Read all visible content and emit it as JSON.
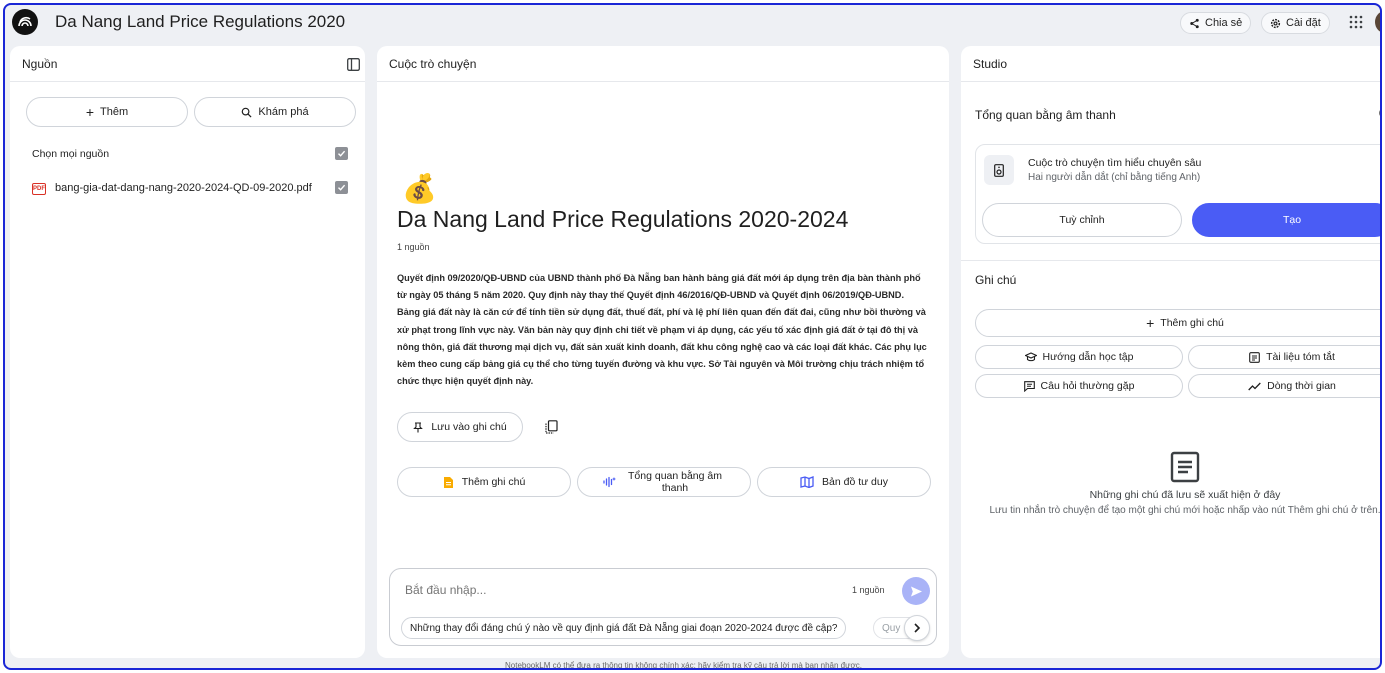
{
  "header": {
    "title": "Da Nang Land Price Regulations 2020-2024",
    "share_label": "Chia sẻ",
    "settings_label": "Cài đặt"
  },
  "sources": {
    "panel_title": "Nguồn",
    "add_label": "Thêm",
    "discover_label": "Khám phá",
    "select_all_label": "Chọn mọi nguồn",
    "pdf_badge": "PDF",
    "items": [
      {
        "name": "bang-gia-dat-dang-nang-2020-2024-QD-09-2020.pdf",
        "checked": true
      }
    ]
  },
  "chat": {
    "panel_title": "Cuộc trò chuyện",
    "emoji": "💰",
    "notebook_title": "Da Nang Land Price Regulations 2020-2024",
    "source_count": "1 nguồn",
    "summary": "Quyết định 09/2020/QĐ-UBND của UBND thành phố Đà Nẵng ban hành bảng giá đất mới áp dụng trên địa bàn thành phố từ ngày 05 tháng 5 năm 2020. Quy định này thay thế Quyết định 46/2016/QĐ-UBND và Quyết định 06/2019/QĐ-UBND. Bảng giá đất này là căn cứ để tính tiền sử dụng đất, thuế đất, phí và lệ phí liên quan đến đất đai, cũng như bồi thường và xử phạt trong lĩnh vực này. Văn bản này quy định chi tiết về phạm vi áp dụng, các yếu tố xác định giá đất ở tại đô thị và nông thôn, giá đất thương mại dịch vụ, đất sản xuất kinh doanh, đất khu công nghệ cao và các loại đất khác. Các phụ lục kèm theo cung cấp bảng giá cụ thể cho từng tuyến đường và khu vực. Sở Tài nguyên và Môi trường chịu trách nhiệm tổ chức thực hiện quyết định này.",
    "save_note_label": "Lưu vào ghi chú",
    "add_note_label": "Thêm ghi chú",
    "audio_overview_label": "Tổng quan bằng âm thanh",
    "mind_map_label": "Bản đồ tư duy",
    "input_placeholder": "Bắt đầu nhập...",
    "input_source_count": "1 nguồn",
    "suggestion": "Những thay đổi đáng chú ý nào về quy định giá đất Đà Nẵng giai đoạn 2020-2024 được đề cập?",
    "suggestion_2": "Quy",
    "disclaimer": "NotebookLM có thể đưa ra thông tin không chính xác; hãy kiểm tra kỹ câu trả lời mà bạn nhận được."
  },
  "studio": {
    "panel_title": "Studio",
    "audio_section_title": "Tổng quan bằng âm thanh",
    "audio_card_title": "Cuộc trò chuyện tìm hiểu chuyên sâu",
    "audio_card_subtitle": "Hai người dẫn dắt (chỉ bằng tiếng Anh)",
    "customize_label": "Tuỳ chỉnh",
    "generate_label": "Tạo",
    "notes_section_title": "Ghi chú",
    "add_note_label": "Thêm ghi chú",
    "study_guide_label": "Hướng dẫn học tập",
    "briefing_doc_label": "Tài liệu tóm tắt",
    "faq_label": "Câu hỏi thường gặp",
    "timeline_label": "Dòng thời gian",
    "empty_title": "Những ghi chú đã lưu sẽ xuất hiện ở đây",
    "empty_desc": "Lưu tin nhắn trò chuyện để tạo một ghi chú mới hoặc nhấp vào nút Thêm ghi chú ở trên."
  },
  "colors": {
    "accent": "#4a5cf5",
    "frame": "#1a26d6",
    "background": "#eef0f4"
  }
}
